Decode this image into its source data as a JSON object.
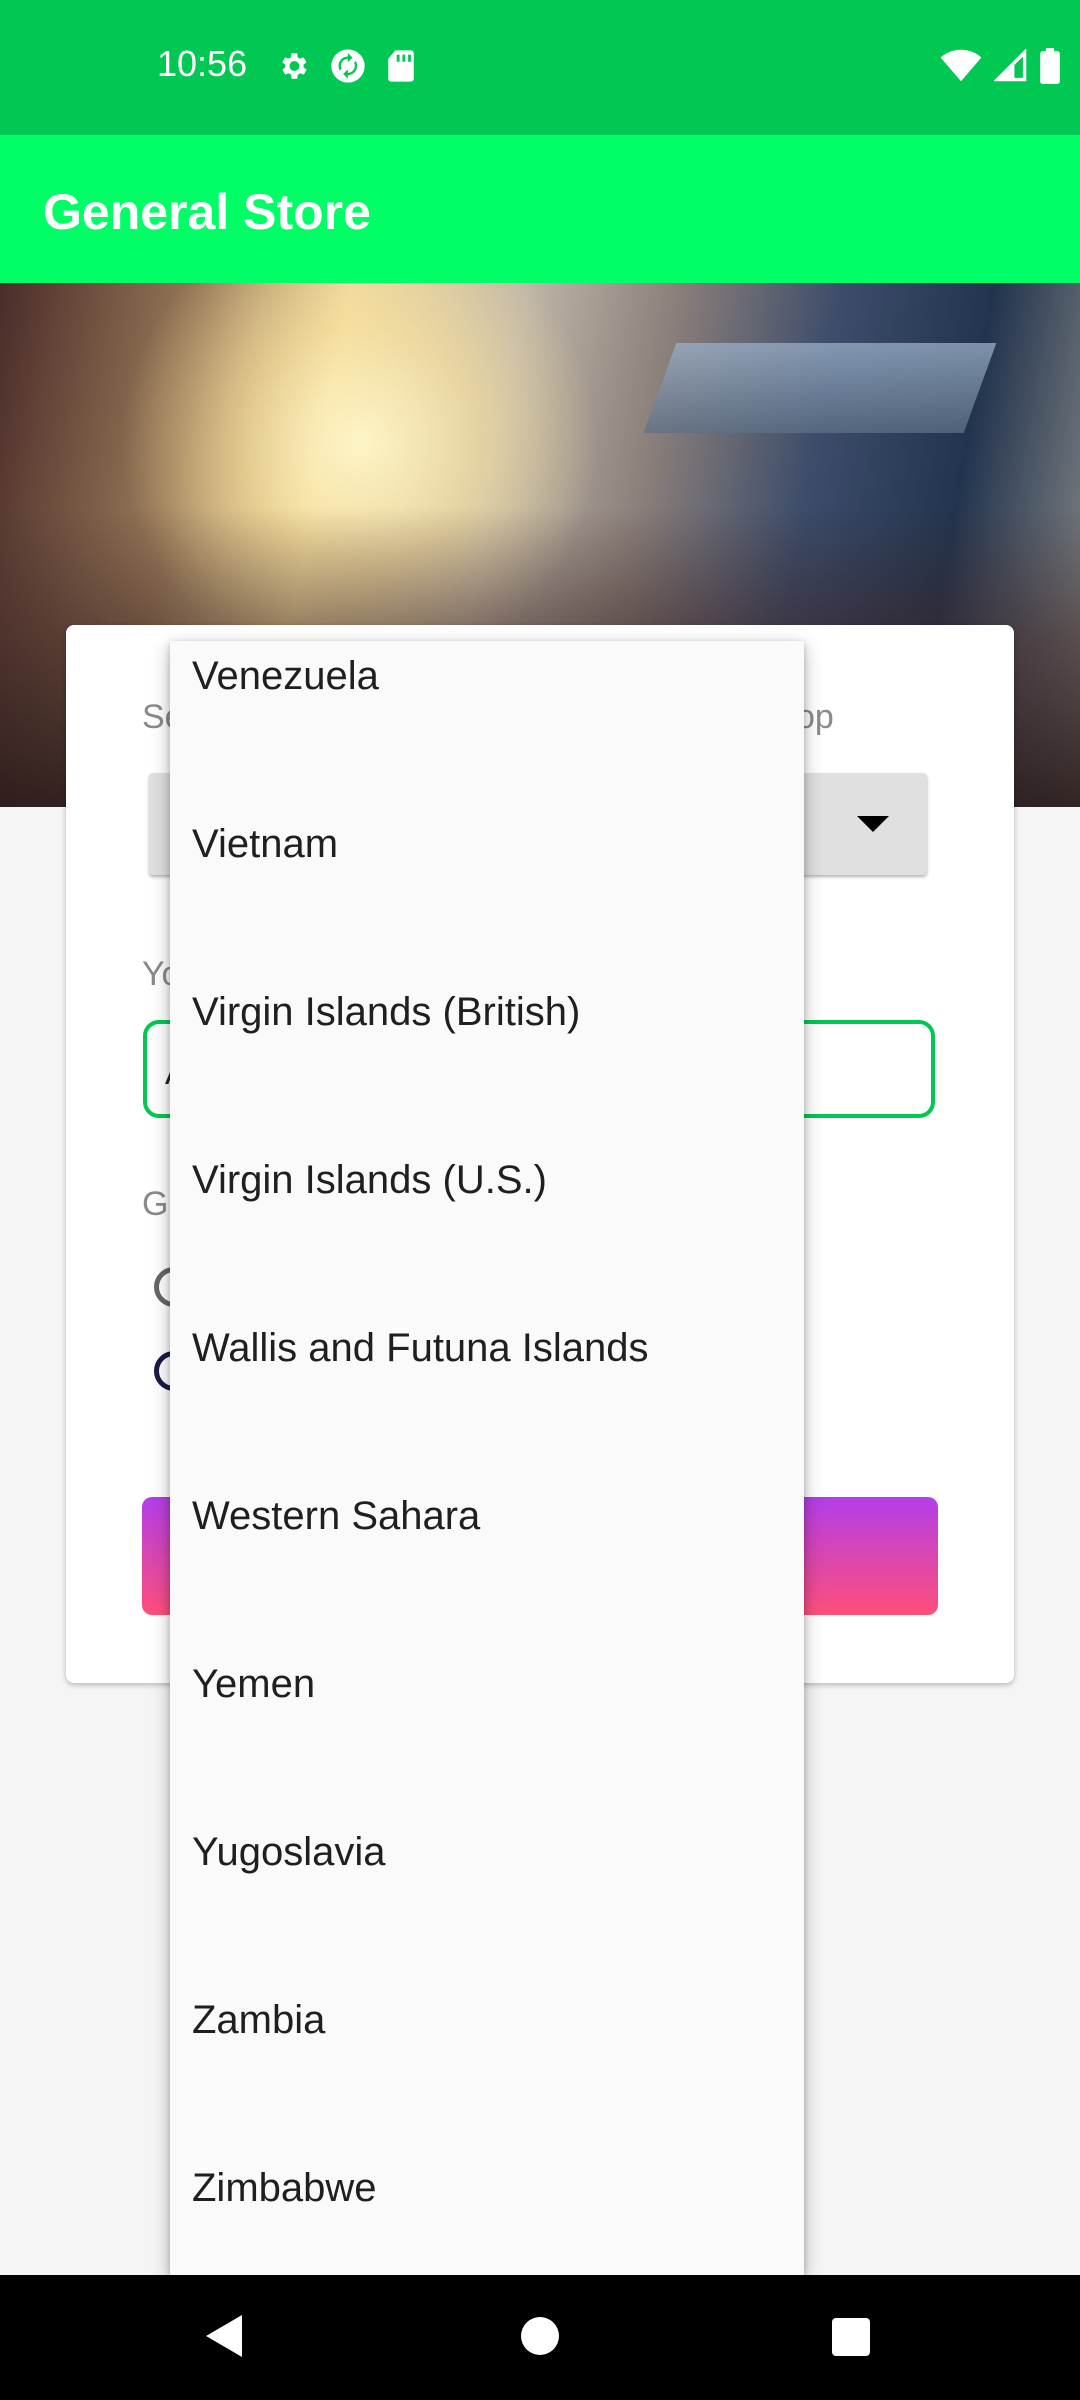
{
  "status_bar": {
    "time": "10:56",
    "icons_left": [
      "gear-icon",
      "sync-icon",
      "sd-card-icon"
    ],
    "icons_right": [
      "wifi-icon",
      "signal-icon",
      "battery-icon"
    ]
  },
  "app_bar": {
    "title": "General Store"
  },
  "form": {
    "country_label_visible_start": "Se",
    "country_label_visible_end": "op",
    "name_label_visible": "Yo",
    "name_value_visible": "A",
    "gender_label_visible": "Ge"
  },
  "dropdown": {
    "items": [
      "Venezuela",
      "Vietnam",
      "Virgin Islands (British)",
      "Virgin Islands (U.S.)",
      "Wallis and Futuna Islands",
      "Western Sahara",
      "Yemen",
      "Yugoslavia",
      "Zambia",
      "Zimbabwe"
    ]
  },
  "colors": {
    "status_bar": "#00c853",
    "app_bar": "#00ff66",
    "accent": "#00c853",
    "button_gradient_top": "#b33ee8",
    "button_gradient_bottom": "#ff4f7a"
  }
}
